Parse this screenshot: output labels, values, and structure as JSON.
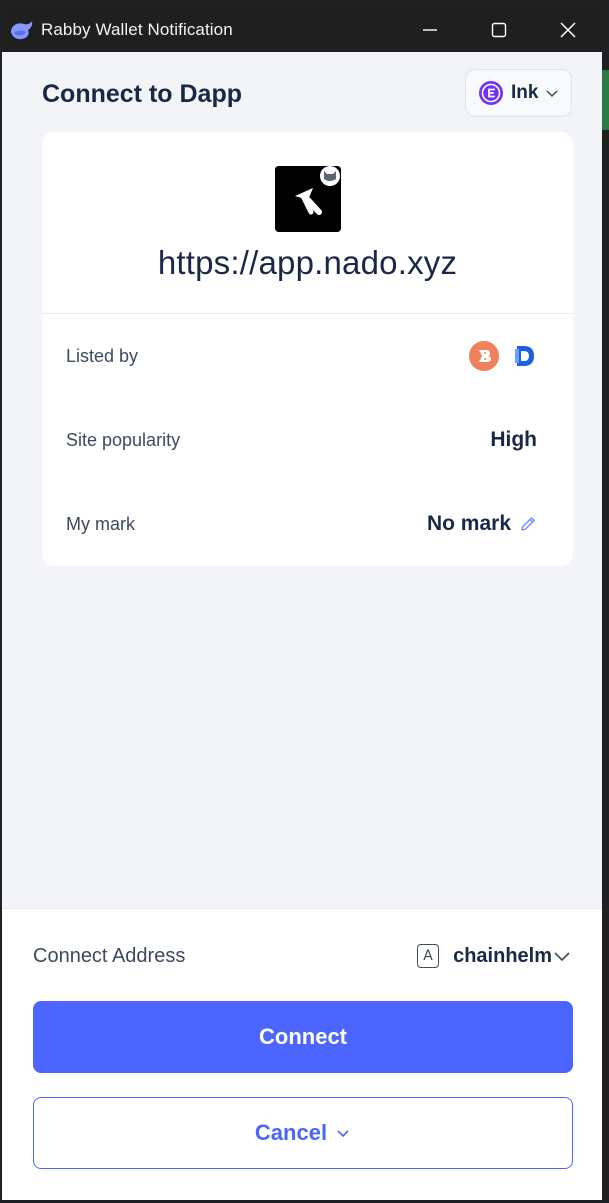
{
  "window": {
    "title": "Rabby Wallet Notification",
    "app_icon": "rabby-logo-icon",
    "controls": [
      "minimize-icon",
      "maximize-icon",
      "close-icon"
    ]
  },
  "header": {
    "title": "Connect to Dapp",
    "chain": {
      "name": "Ink",
      "icon": "ink-chain-icon",
      "accent": "#7132f5"
    }
  },
  "dapp": {
    "icon": "nado-logo-icon",
    "url": "https://app.nado.xyz"
  },
  "rows": {
    "listed_by": {
      "label": "Listed by",
      "icons": [
        "listing-source-1-icon",
        "listing-source-2-icon"
      ]
    },
    "site_popularity": {
      "label": "Site popularity",
      "value": "High"
    },
    "my_mark": {
      "label": "My mark",
      "value": "No mark"
    }
  },
  "footer": {
    "address_label": "Connect Address",
    "address_badge": "A",
    "address_name": "chainhelm",
    "connect_label": "Connect",
    "cancel_label": "Cancel"
  },
  "colors": {
    "primary": "#4c65ff",
    "text_dark": "#192945",
    "text_muted": "#3e495e",
    "background": "#f2f4f7",
    "titlebar": "#1f1f1f"
  }
}
